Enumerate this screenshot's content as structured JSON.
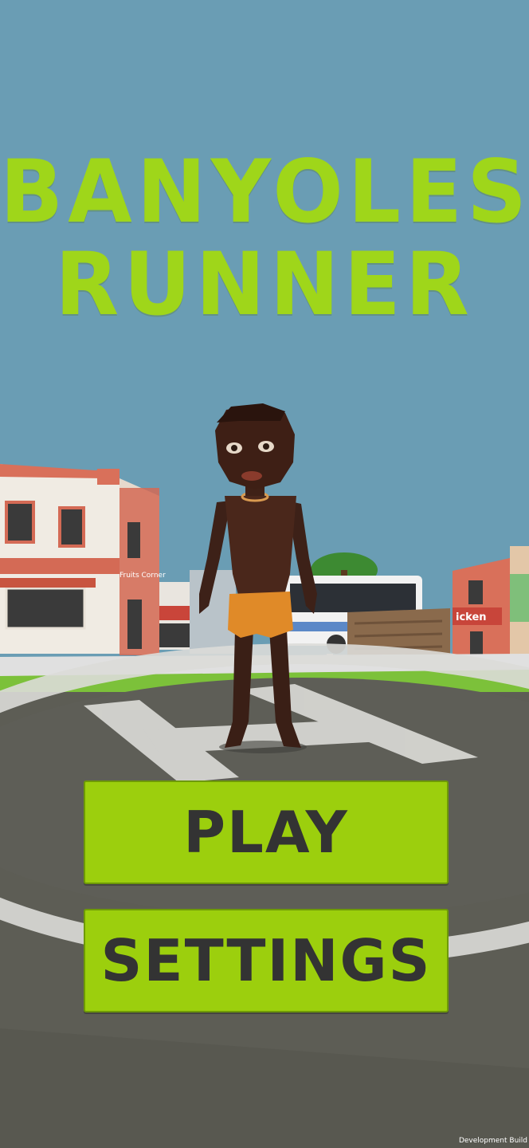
{
  "title": {
    "line1": "BANYOLES",
    "line2": "RUNNER"
  },
  "menu": {
    "play_label": "PLAY",
    "settings_label": "SETTINGS"
  },
  "scene": {
    "shop_sign": "Fruits Corner",
    "restaurant_sign": "icken"
  },
  "footer": {
    "build_label": "Development Build"
  },
  "colors": {
    "accent": "#9fd61a",
    "button": "#9ccf0d",
    "sky": "#6a9db4",
    "button_text": "#333333"
  }
}
